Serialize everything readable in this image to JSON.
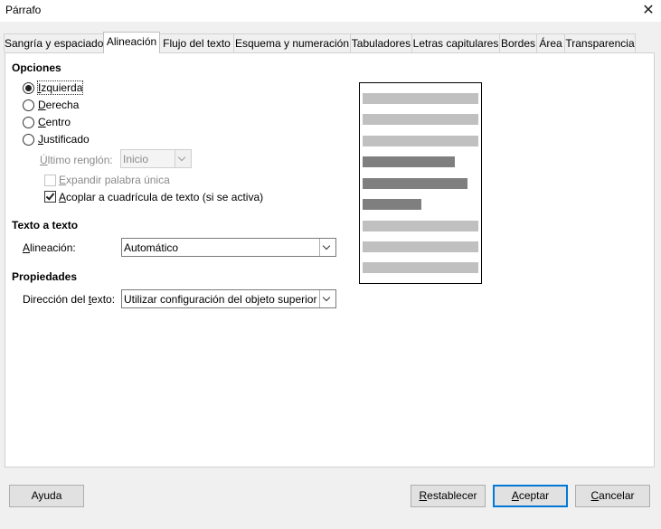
{
  "window": {
    "title": "Párrafo"
  },
  "tabs": [
    {
      "label": "Sangría y espaciado",
      "active": false
    },
    {
      "label": "Alineación",
      "active": true
    },
    {
      "label": "Flujo del texto",
      "active": false
    },
    {
      "label": "Esquema y numeración",
      "active": false
    },
    {
      "label": "Tabuladores",
      "active": false
    },
    {
      "label": "Letras capitulares",
      "active": false
    },
    {
      "label": "Bordes",
      "active": false
    },
    {
      "label": "Área",
      "active": false
    },
    {
      "label": "Transparencia",
      "active": false
    }
  ],
  "options": {
    "title": "Opciones",
    "alignments": [
      {
        "access_key": "I",
        "rest": "zquierda",
        "checked": true
      },
      {
        "access_key": "D",
        "rest": "erecha",
        "checked": false
      },
      {
        "access_key": "C",
        "rest": "entro",
        "checked": false
      },
      {
        "access_key": "J",
        "rest": "ustificado",
        "checked": false
      }
    ],
    "last_line": {
      "access_key": "Ú",
      "rest": "ltimo renglón:",
      "value": "Inicio",
      "enabled": false
    },
    "expand_word": {
      "access_key": "E",
      "rest": "xpandir palabra única",
      "checked": false,
      "enabled": false
    },
    "snap_grid": {
      "access_key": "A",
      "rest": "coplar a cuadrícula de texto (si se activa)",
      "checked": true
    }
  },
  "text_to_text": {
    "title": "Texto a texto",
    "alignment_access_key": "A",
    "alignment_rest": "lineación:",
    "alignment_value": "Automático"
  },
  "properties": {
    "title": "Propiedades",
    "direction_before": "Dirección del ",
    "direction_access_key": "t",
    "direction_after": "exto:",
    "direction_value": "Utilizar configuración del objeto superior"
  },
  "preview": {
    "lines": [
      {
        "width_pct": 100,
        "color": "#c0c0c0"
      },
      {
        "width_pct": 100,
        "color": "#c0c0c0"
      },
      {
        "width_pct": 100,
        "color": "#c0c0c0"
      },
      {
        "width_pct": 80,
        "color": "#7f7f7f"
      },
      {
        "width_pct": 91,
        "color": "#7f7f7f"
      },
      {
        "width_pct": 51,
        "color": "#7f7f7f"
      },
      {
        "width_pct": 100,
        "color": "#c0c0c0"
      },
      {
        "width_pct": 100,
        "color": "#c0c0c0"
      },
      {
        "width_pct": 100,
        "color": "#c0c0c0"
      }
    ]
  },
  "buttons": {
    "help": "Ayuda",
    "reset_key": "R",
    "reset_rest": "establecer",
    "ok_key": "A",
    "ok_rest": "ceptar",
    "cancel_key": "C",
    "cancel_rest": "ancelar"
  },
  "colors": {
    "accent": "#0078d7",
    "panel": "#ffffff",
    "background": "#f0f0f0"
  }
}
